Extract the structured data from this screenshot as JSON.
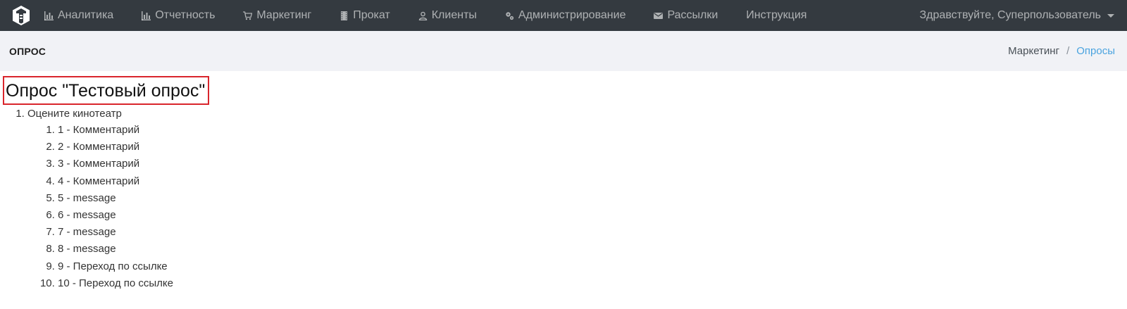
{
  "nav": {
    "items": [
      {
        "label": "Аналитика",
        "icon": "bar-chart-icon"
      },
      {
        "label": "Отчетность",
        "icon": "bar-chart-icon"
      },
      {
        "label": "Маркетинг",
        "icon": "cart-icon"
      },
      {
        "label": "Прокат",
        "icon": "film-icon"
      },
      {
        "label": "Клиенты",
        "icon": "user-icon"
      },
      {
        "label": "Администрирование",
        "icon": "gears-icon"
      },
      {
        "label": "Рассылки",
        "icon": "envelope-icon"
      },
      {
        "label": "Инструкция",
        "icon": ""
      }
    ],
    "greeting": "Здравствуйте, Суперпользователь"
  },
  "subheader": {
    "title": "ОПРОС",
    "breadcrumb": [
      "Маркетинг",
      "Опросы"
    ]
  },
  "survey": {
    "title": "Опрос \"Тестовый опрос\"",
    "questions": [
      {
        "text": "Оцените кинотеатр",
        "answers": [
          "1 - Комментарий",
          "2 - Комментарий",
          "3 - Комментарий",
          "4 - Комментарий",
          "5 - message",
          "6 - message",
          "7 - message",
          "8 - message",
          "9 - Переход по ссылке",
          "10 - Переход по ссылке"
        ]
      }
    ]
  },
  "colors": {
    "navbar": "#343a40",
    "subheader": "#f1f2f6",
    "breadcrumb_active": "#4aa3df",
    "highlight_border": "#d9252c"
  }
}
